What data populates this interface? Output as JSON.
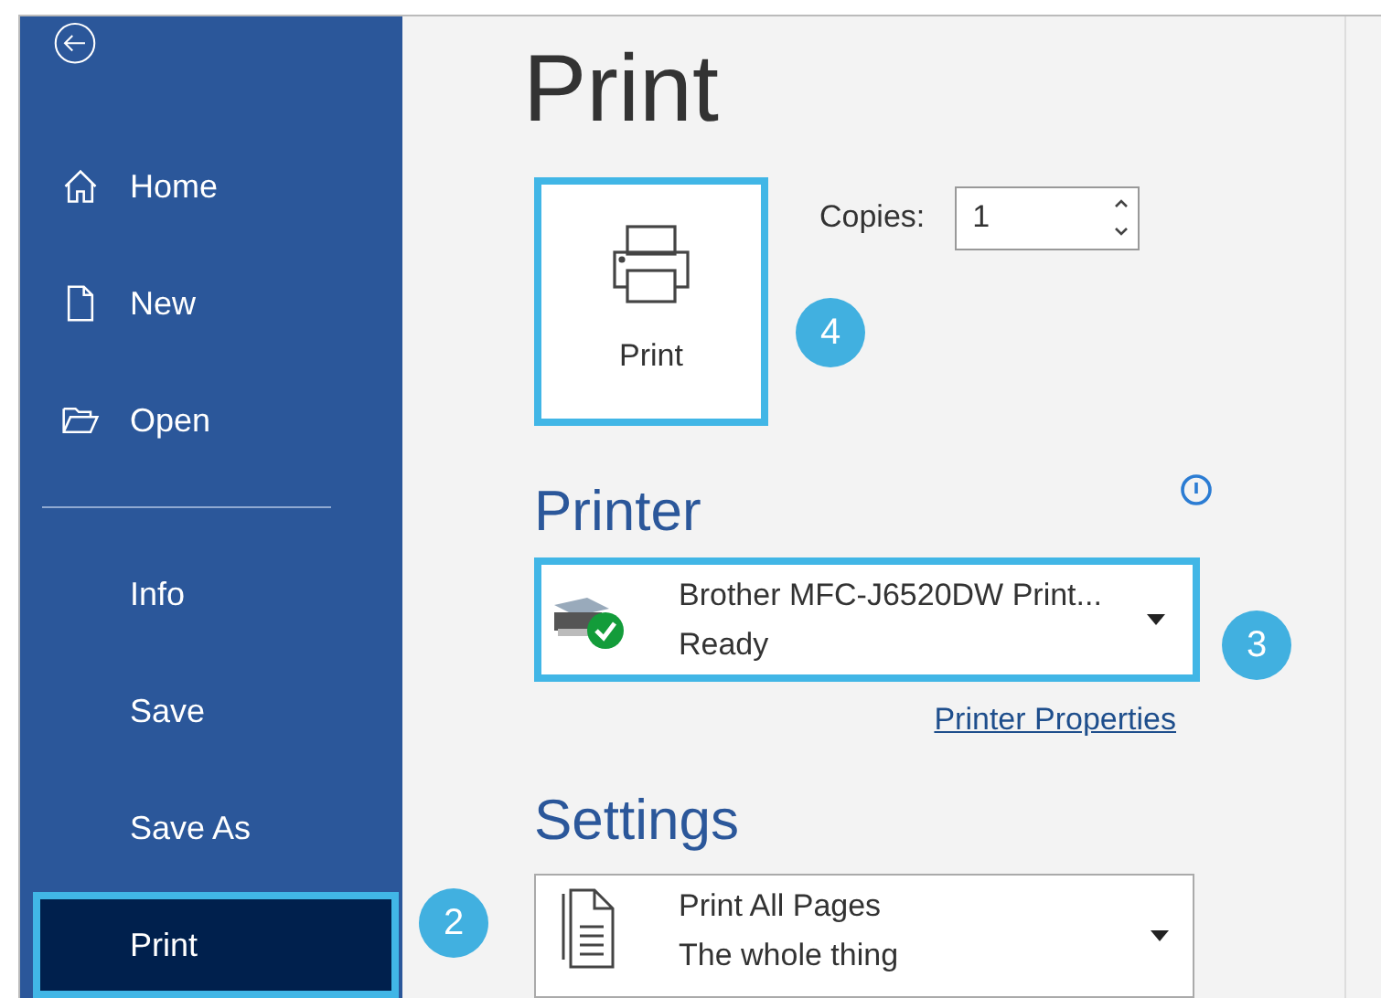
{
  "sidebar": {
    "top_items": [
      {
        "label": "Home",
        "kind": "home",
        "selected": false
      },
      {
        "label": "New",
        "kind": "new",
        "selected": false
      },
      {
        "label": "Open",
        "kind": "open",
        "selected": false
      }
    ],
    "bottom_items": [
      {
        "label": "Info",
        "kind": "plain",
        "selected": false
      },
      {
        "label": "Save",
        "kind": "plain",
        "selected": false
      },
      {
        "label": "Save As",
        "kind": "plain",
        "selected": false
      },
      {
        "label": "Print",
        "kind": "plain",
        "selected": true
      }
    ]
  },
  "title": "Print",
  "print_button": {
    "label": "Print"
  },
  "copies": {
    "label": "Copies:",
    "value": "1"
  },
  "printer": {
    "heading": "Printer",
    "name": "Brother MFC-J6520DW Print...",
    "status": "Ready",
    "properties_link": "Printer Properties"
  },
  "settings": {
    "heading": "Settings",
    "option": "Print All Pages",
    "detail": "The whole thing"
  },
  "callouts": [
    "2",
    "3",
    "4"
  ]
}
